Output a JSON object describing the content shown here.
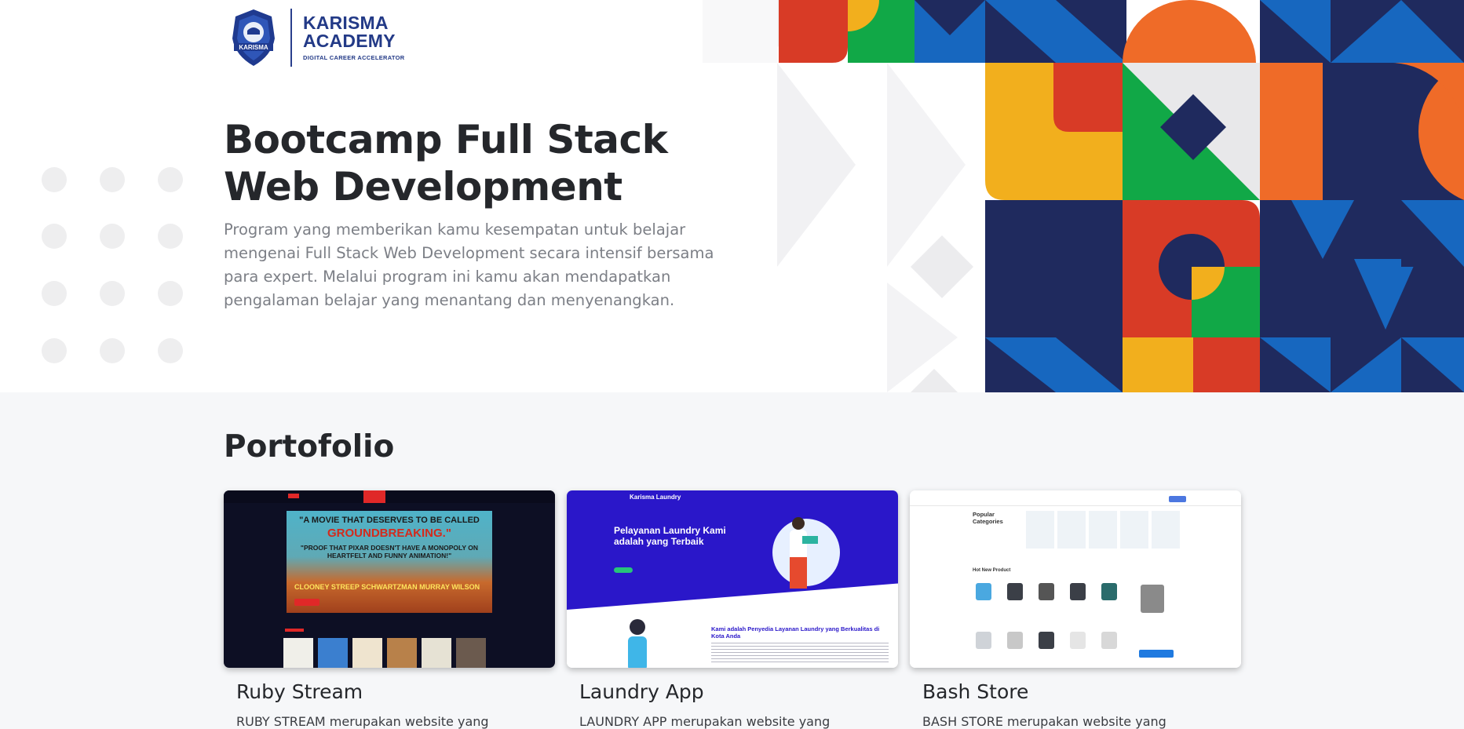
{
  "brand": {
    "line1": "KARISMA",
    "line2": "ACADEMY",
    "tagline": "DIGITAL CAREER ACCELERATOR",
    "emblem_text": "KARISMA"
  },
  "hero": {
    "title_line1": "Bootcamp Full Stack",
    "title_line2": "Web Development",
    "description": "Program yang memberikan kamu kesempatan untuk belajar mengenai Full Stack Web Development secara intensif bersama para expert. Melalui program ini kamu akan mendapatkan pengalaman belajar yang menantang dan menyenangkan."
  },
  "portfolio": {
    "heading": "Portofolio",
    "cards": [
      {
        "title": "Ruby Stream",
        "description": "RUBY STREAM merupakan website yang",
        "preview": {
          "quote1": "\"A MOVIE THAT DESERVES TO BE CALLED",
          "quote2": "GROUNDBREAKING.\"",
          "quote3": "\"PROOF THAT PIXAR DOESN'T HAVE A MONOPOLY ON HEARTFELT AND FUNNY ANIMATION!\"",
          "cast": "CLOONEY STREEP SCHWARTZMAN MURRAY WILSON"
        }
      },
      {
        "title": "Laundry App",
        "description": "LAUNDRY APP merupakan website yang",
        "preview": {
          "brand": "Karisma Laundry",
          "headline": "Pelayanan Laundry Kami adalah yang Terbaik",
          "subheadline": "Kami adalah Penyedia Layanan Laundry yang Berkualitas di Kota Anda"
        }
      },
      {
        "title": "Bash Store",
        "description": "BASH STORE merupakan website yang",
        "preview": {
          "section1": "Popular Categories",
          "section2": "Hot New Product"
        }
      }
    ]
  },
  "colors": {
    "navy": "#1f2a5e",
    "blue": "#1767bf",
    "red": "#d83b26",
    "orange": "#ef6b28",
    "yellow": "#f2af1d",
    "green": "#11a847",
    "light": "#ececee"
  }
}
